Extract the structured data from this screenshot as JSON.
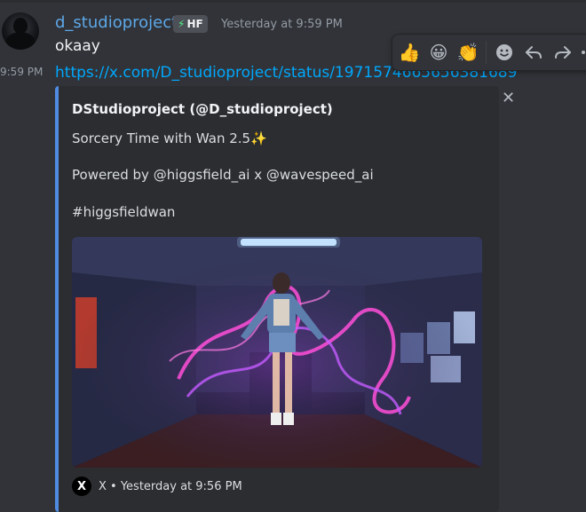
{
  "message": {
    "username": "d_studioproject",
    "tag_icon": "bolt-icon",
    "tag": "HF",
    "timestamp": "Yesterday at 9:59 PM",
    "text": "okaay",
    "side_time": "9:59 PM",
    "link": "https://x.com/D_studioproject/status/1971574665656381689"
  },
  "toolbar": {
    "reactions": [
      "👍",
      "😀",
      "👏"
    ],
    "actions": [
      "add-reaction-icon",
      "reply-icon",
      "forward-icon",
      "more-icon"
    ]
  },
  "embed": {
    "accent": "#4f8be0",
    "author": "DStudioproject (@D_studioproject)",
    "line1": "Sorcery Time with Wan 2.5✨",
    "line2": "Powered by @higgsfield_ai x @wavespeed_ai",
    "line3": "#higgsfieldwan",
    "footer_logo": "X",
    "footer_text": "X • Yesterday at 9:56 PM"
  }
}
